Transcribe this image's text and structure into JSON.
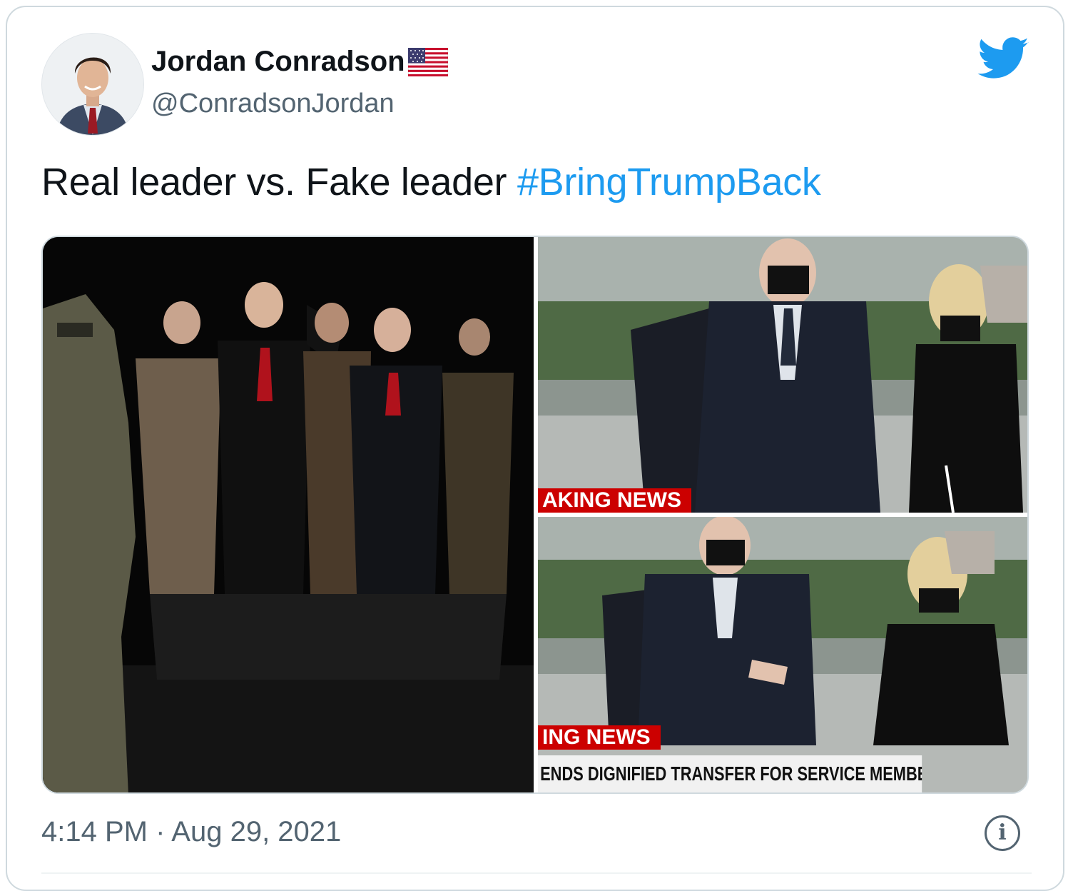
{
  "author": {
    "display_name": "Jordan Conradson",
    "handle": "@ConradsonJordan",
    "flag_icon": "us-flag-icon"
  },
  "tweet": {
    "text": "Real leader vs. Fake leader ",
    "hashtag": "#BringTrumpBack"
  },
  "media": {
    "top_right": {
      "banner": "AKING NEWS"
    },
    "bottom_right": {
      "banner": "ING NEWS",
      "ticker": "ENDS DIGNIFIED TRANSFER FOR SERVICE MEMBERS KILLED IN KABU"
    }
  },
  "meta": {
    "timestamp": "4:14 PM · Aug 29, 2021",
    "info_glyph": "i"
  },
  "colors": {
    "accent": "#1d9bf0",
    "text": "#0f1419",
    "secondary_text": "#536471",
    "breaking_red": "#cc0000"
  },
  "icons": [
    "twitter-bird-icon",
    "info-icon",
    "us-flag-icon"
  ]
}
